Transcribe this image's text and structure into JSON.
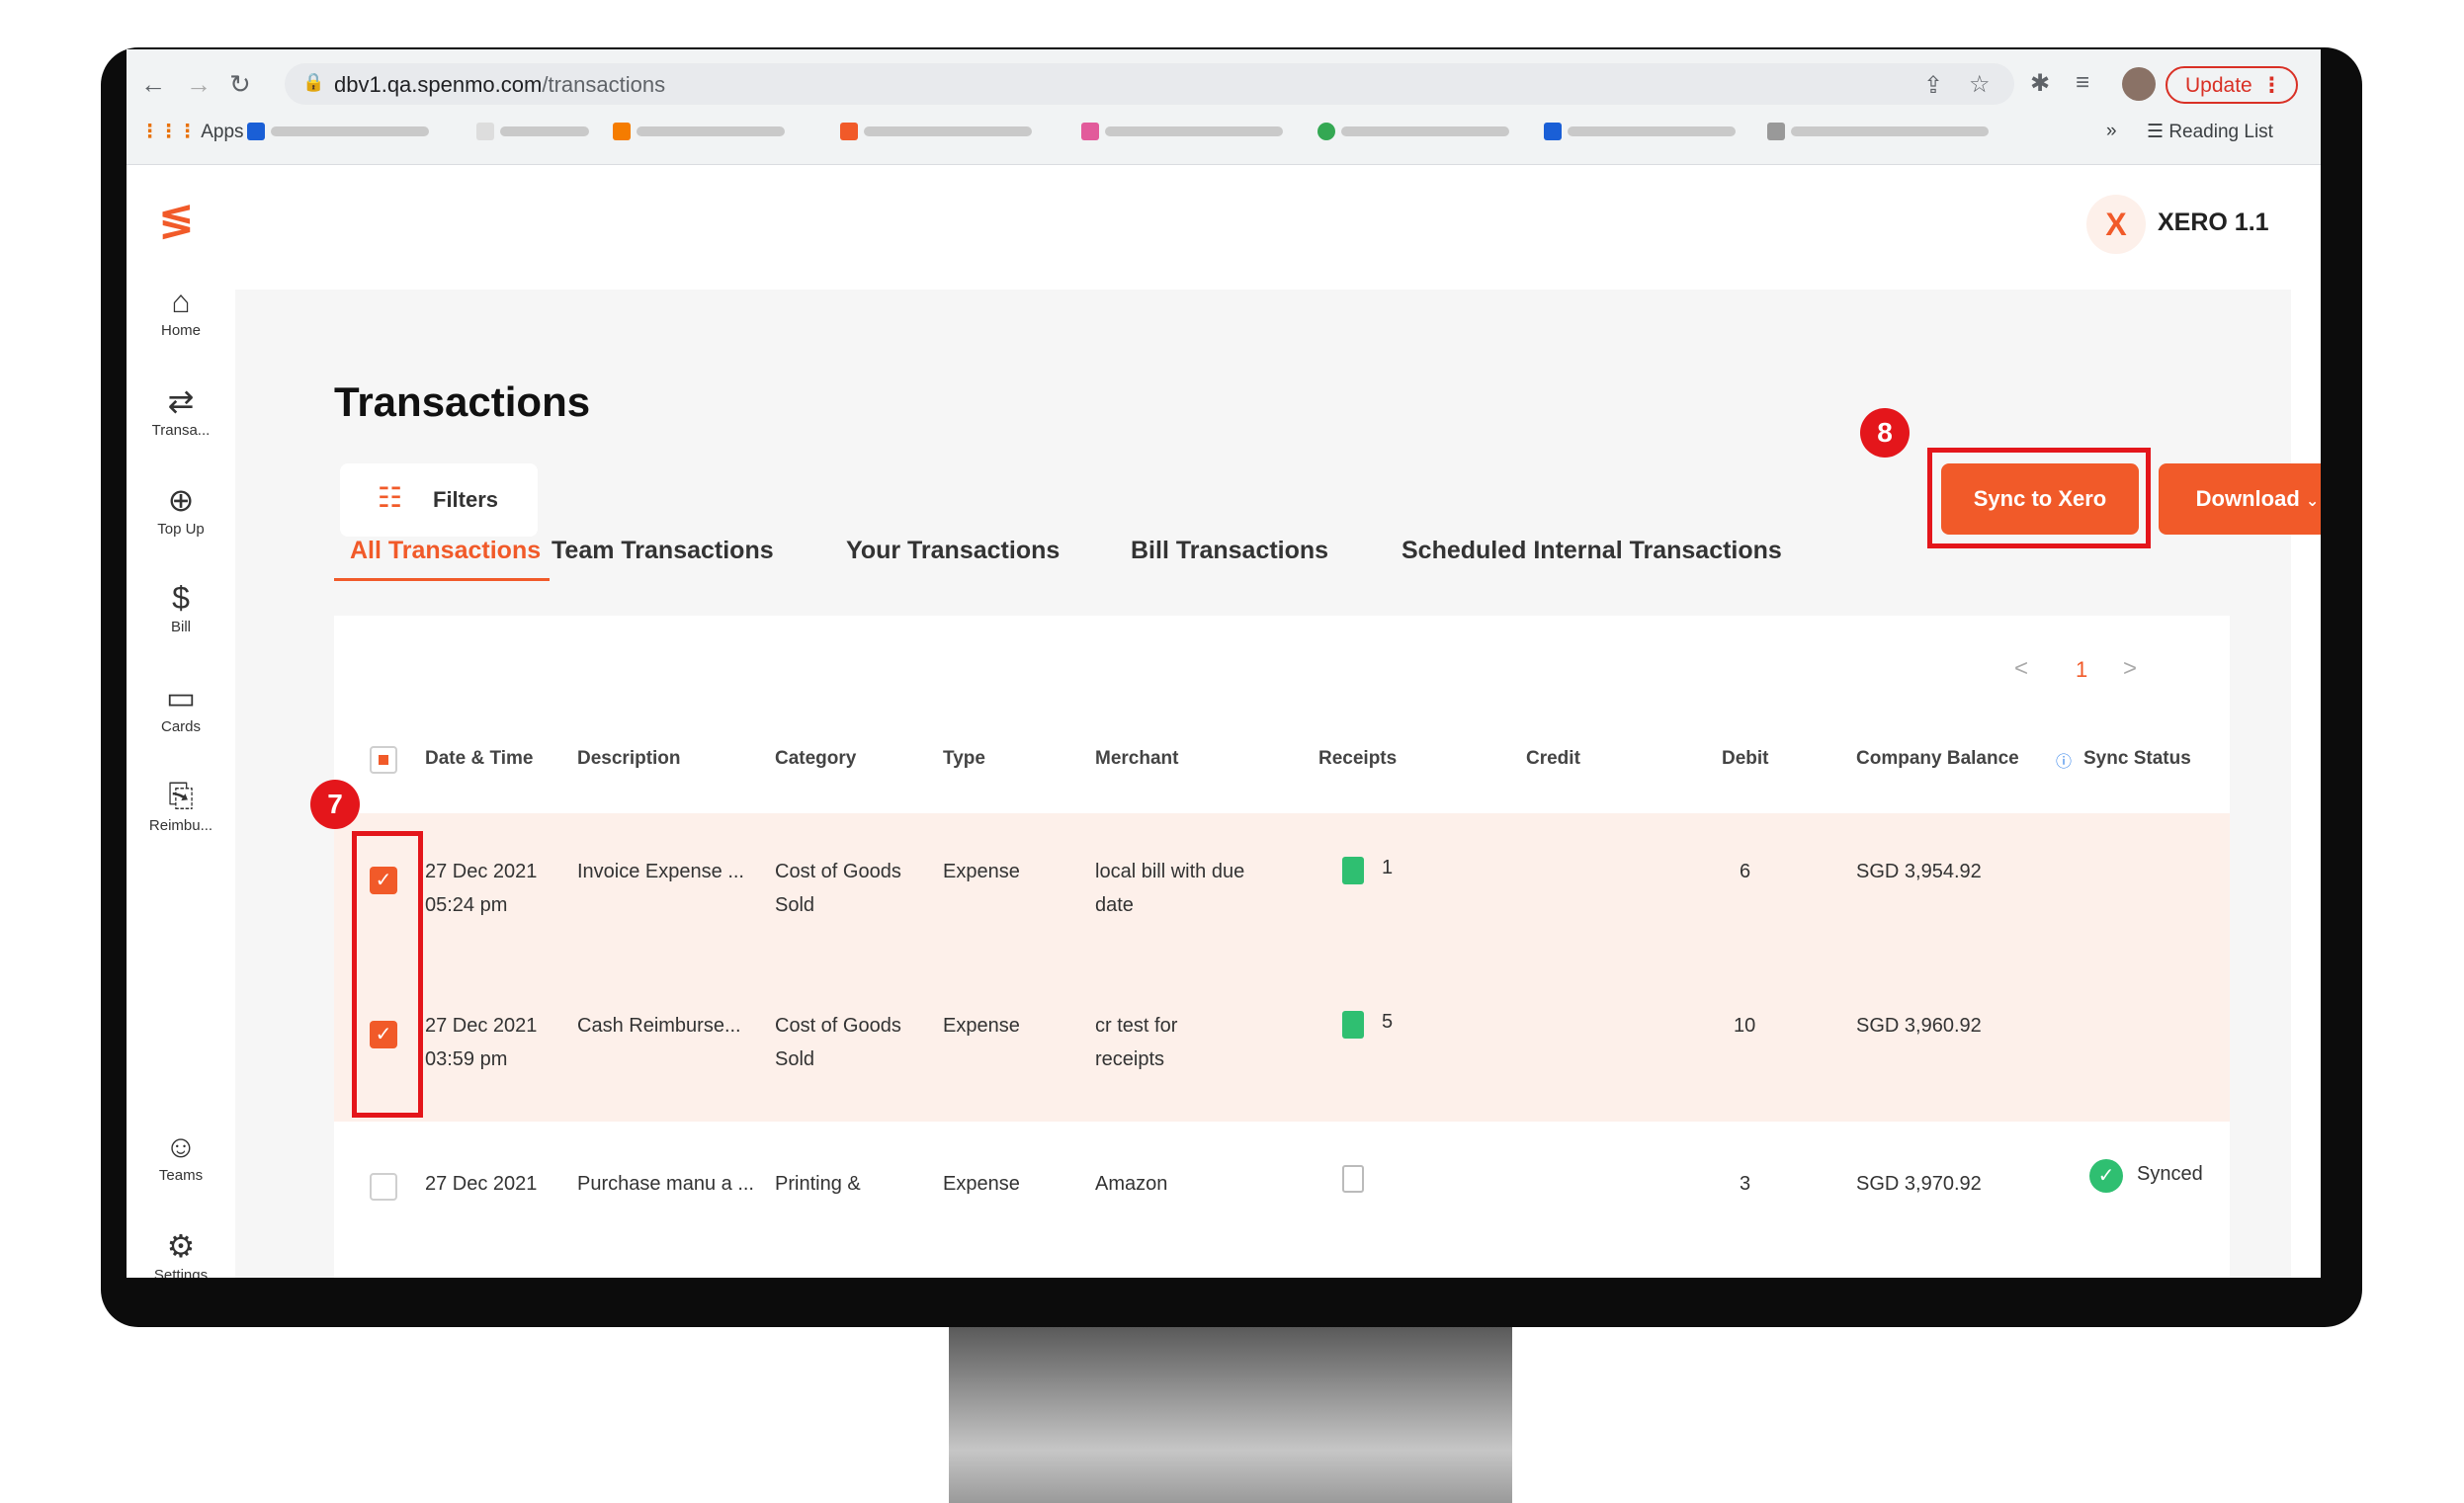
{
  "browser": {
    "url_domain": "dbv1.qa.spenmo.com",
    "url_path": "/transactions",
    "update_label": "Update",
    "apps_label": "Apps",
    "reading_list_label": "Reading List",
    "more_bookmarks": "»"
  },
  "sidebar": {
    "items": [
      {
        "label": "Home",
        "icon": "home-icon"
      },
      {
        "label": "Transa...",
        "icon": "transfer-icon"
      },
      {
        "label": "Top Up",
        "icon": "topup-icon"
      },
      {
        "label": "Bill",
        "icon": "bill-icon"
      },
      {
        "label": "Cards",
        "icon": "card-icon"
      },
      {
        "label": "Reimbu...",
        "icon": "reimburse-icon"
      },
      {
        "label": "Teams",
        "icon": "teams-icon"
      },
      {
        "label": "Settings",
        "icon": "gear-icon"
      }
    ]
  },
  "org": {
    "initial": "X",
    "name": "XERO 1.1"
  },
  "page": {
    "title": "Transactions",
    "filters_label": "Filters",
    "sync_label": "Sync to Xero",
    "download_label": "Download",
    "annotation_sync": "8",
    "annotation_rows": "7"
  },
  "tabs": [
    {
      "label": "All Transactions",
      "active": true
    },
    {
      "label": "Team Transactions",
      "active": false
    },
    {
      "label": "Your Transactions",
      "active": false
    },
    {
      "label": "Bill Transactions",
      "active": false
    },
    {
      "label": "Scheduled Internal Transactions",
      "active": false
    }
  ],
  "pagination": {
    "prev": "<",
    "page": "1",
    "next": ">"
  },
  "table": {
    "headers": [
      "Date & Time",
      "Description",
      "Category",
      "Type",
      "Merchant",
      "Receipts",
      "Credit",
      "Debit",
      "Company Balance",
      "Sync Status"
    ],
    "rows": [
      {
        "selected": true,
        "date": "27 Dec 2021",
        "time": "05:24 pm",
        "description": "Invoice Expense ...",
        "category_1": "Cost of Goods",
        "category_2": "Sold",
        "type": "Expense",
        "merchant_1": "local bill with due",
        "merchant_2": "date",
        "receipts": "1",
        "credit": "",
        "debit": "6",
        "balance": "SGD 3,954.92",
        "sync": ""
      },
      {
        "selected": true,
        "date": "27 Dec 2021",
        "time": "03:59 pm",
        "description": "Cash Reimburse...",
        "category_1": "Cost of Goods",
        "category_2": "Sold",
        "type": "Expense",
        "merchant_1": "cr test for",
        "merchant_2": "receipts",
        "receipts": "5",
        "credit": "",
        "debit": "10",
        "balance": "SGD 3,960.92",
        "sync": ""
      },
      {
        "selected": false,
        "date": "27 Dec 2021",
        "time": "",
        "description": "Purchase manu a ...",
        "category_1": "Printing &",
        "category_2": "",
        "type": "Expense",
        "merchant_1": "Amazon",
        "merchant_2": "",
        "receipts": "",
        "credit": "",
        "debit": "3",
        "balance": "SGD 3,970.92",
        "sync": "Synced"
      }
    ]
  },
  "colors": {
    "brand": "#f15a29",
    "annotation": "#e4161b",
    "success": "#2fbf71",
    "selected_row": "#fdf0ea"
  }
}
